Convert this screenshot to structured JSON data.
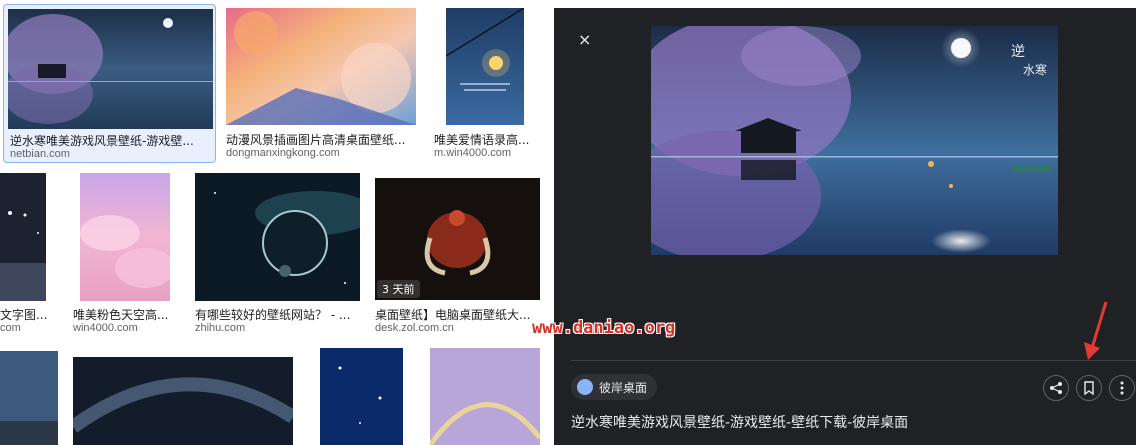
{
  "results": [
    {
      "caption": "逆水寒唯美游戏风景壁纸-游戏壁...",
      "source": "netbian.com"
    },
    {
      "caption": "动漫风景插画图片高清桌面壁纸...",
      "source": "dongmanxingkong.com"
    },
    {
      "caption": "唯美爱情语录高...",
      "source": "m.win4000.com"
    },
    {
      "caption": "文字图...",
      "source": "com"
    },
    {
      "caption": "唯美粉色天空高...",
      "source": "win4000.com"
    },
    {
      "caption": "有哪些较好的壁纸网站？ - ...",
      "source": "zhihu.com"
    },
    {
      "caption": "桌面壁纸】电脑桌面壁纸大...",
      "source": "desk.zol.com.cn",
      "badge": "3 天前"
    }
  ],
  "panel": {
    "close_glyph": "×",
    "source_chip": "彼岸桌面",
    "title": "逆水寒唯美游戏风景壁纸-游戏壁纸-壁纸下载-彼岸桌面"
  },
  "watermark": "www.daniao.org",
  "colors": {
    "panel_bg": "#202124",
    "arrow": "#e53935",
    "watermark": "#d93025",
    "selected_border": "#8ab4f8"
  },
  "icons": [
    "close-icon",
    "globe-icon",
    "share-icon",
    "bookmark-icon",
    "more-vert-icon",
    "arrow-icon"
  ]
}
